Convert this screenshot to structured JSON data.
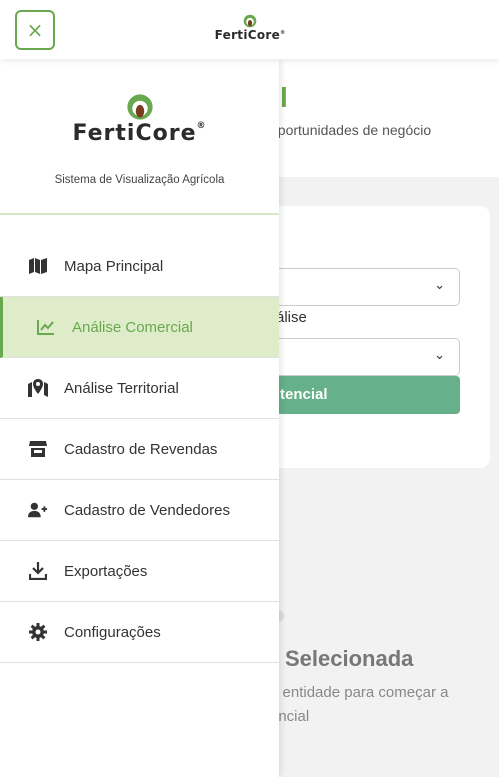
{
  "header": {
    "close_label": "×",
    "brand": "FertiCore",
    "registered": "®"
  },
  "background": {
    "title_fragment": "l",
    "subtitle_fragment": "oportunidades de negócio",
    "select_label_fragment": "álise",
    "button_fragment": "tencial",
    "empty_title_fragment": "Selecionada",
    "empty_text_line1": "a entidade para começar a",
    "empty_text_line2": "encial"
  },
  "sidebar": {
    "brand": "FertiCore",
    "registered": "®",
    "tagline": "Sistema de Visualização Agrícola",
    "items": [
      {
        "label": "Mapa Principal",
        "icon": "map-icon",
        "active": false
      },
      {
        "label": "Análise Comercial",
        "icon": "chart-line-icon",
        "active": true
      },
      {
        "label": "Análise Territorial",
        "icon": "map-marker-icon",
        "active": false
      },
      {
        "label": "Cadastro de Revendas",
        "icon": "store-icon",
        "active": false
      },
      {
        "label": "Cadastro de Vendedores",
        "icon": "user-plus-icon",
        "active": false
      },
      {
        "label": "Exportações",
        "icon": "download-icon",
        "active": false
      },
      {
        "label": "Configurações",
        "icon": "gear-icon",
        "active": false
      }
    ]
  },
  "colors": {
    "accent": "#6aa84f",
    "active_bg": "#deecc9",
    "button_green": "#66b08a"
  }
}
